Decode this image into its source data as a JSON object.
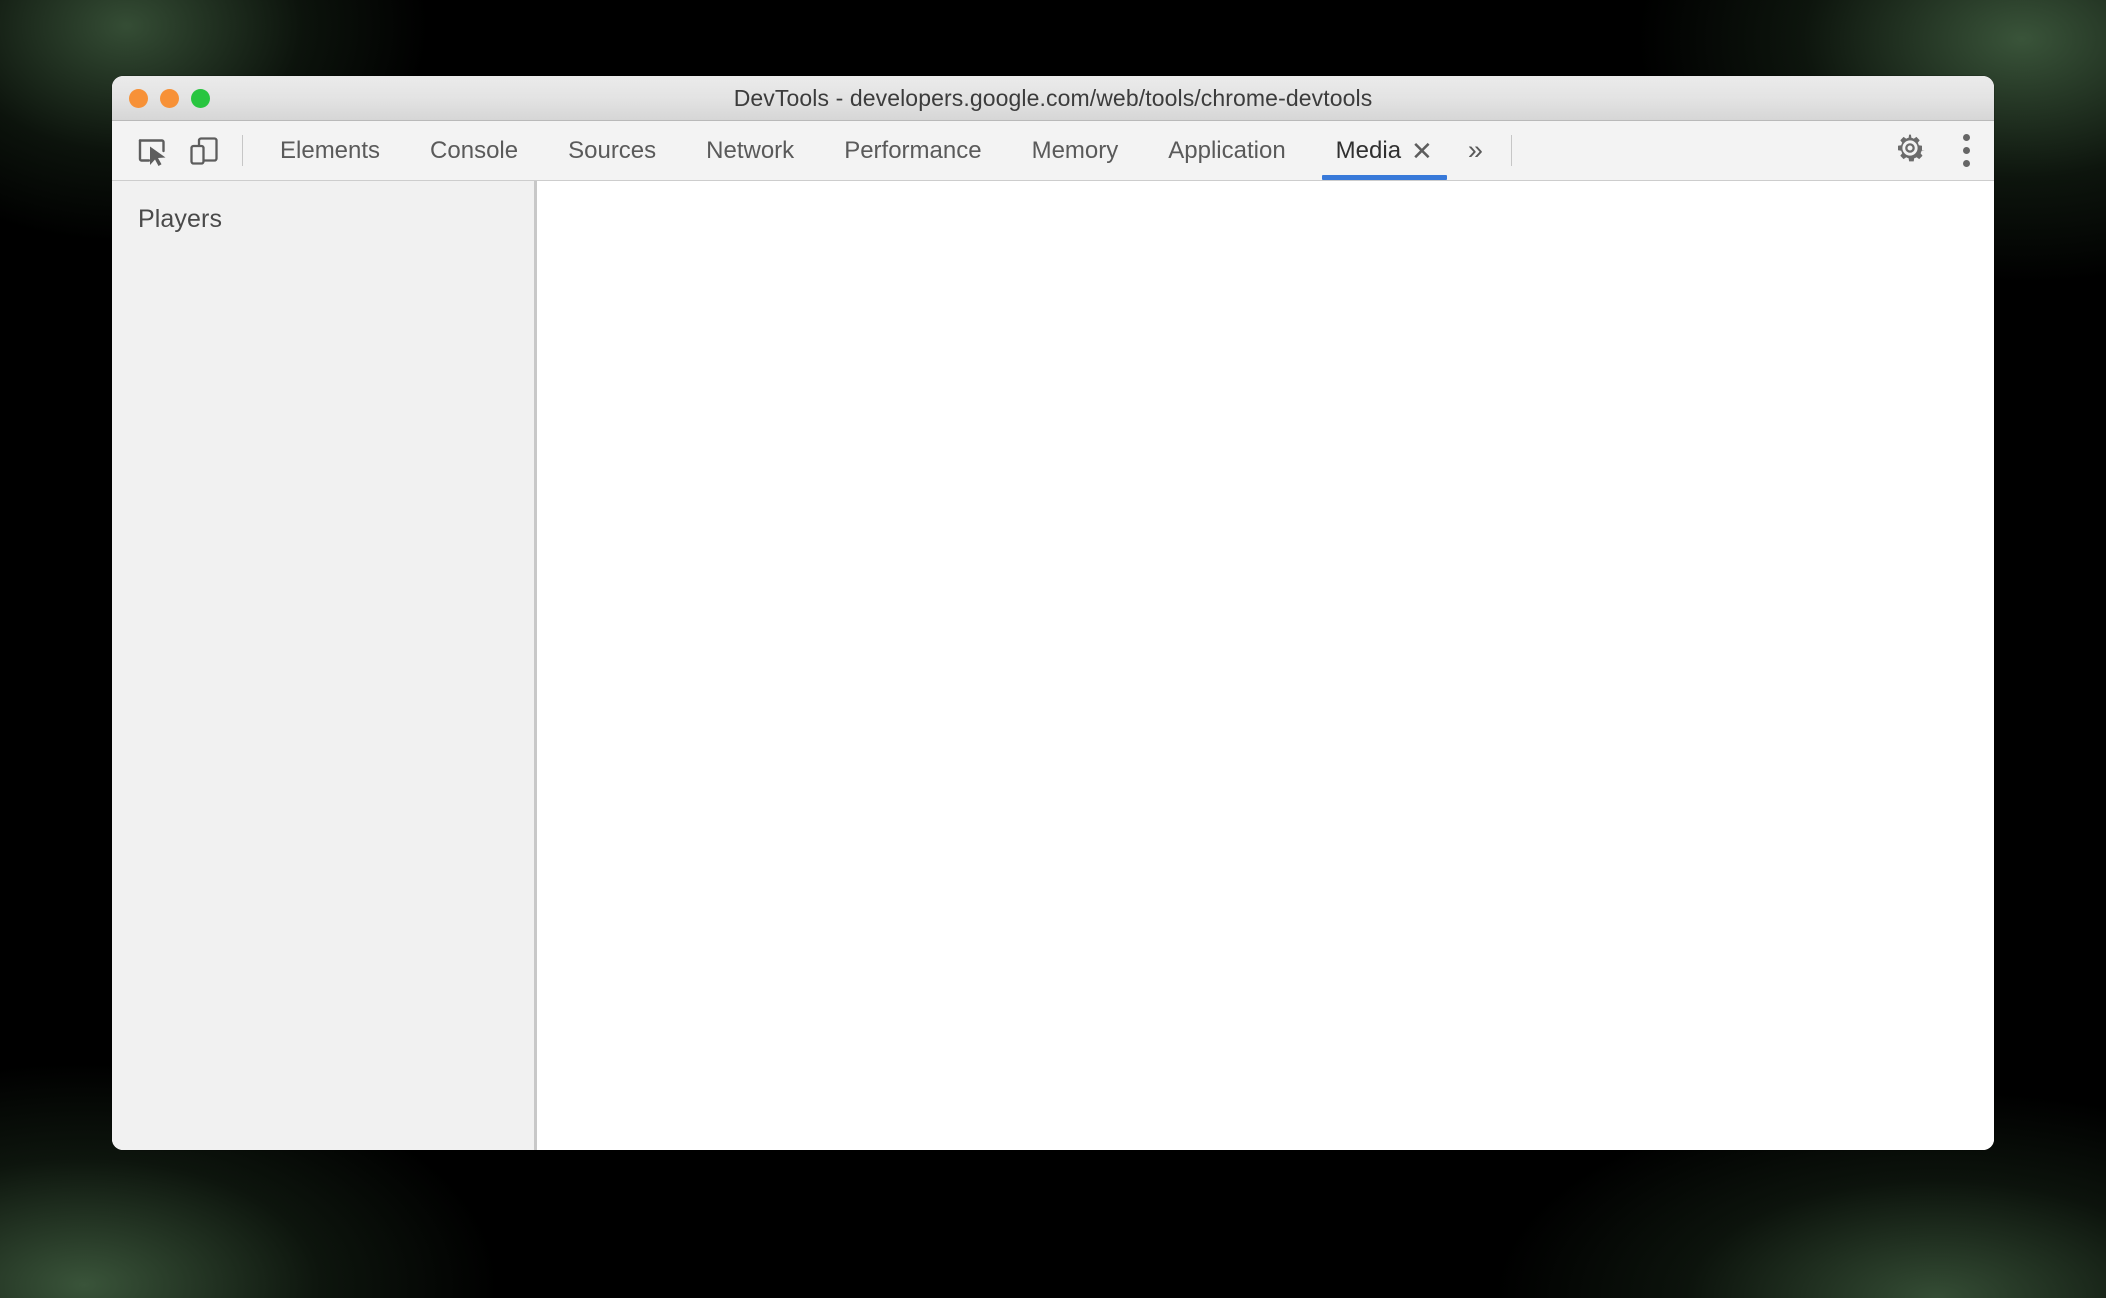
{
  "window": {
    "title": "DevTools - developers.google.com/web/tools/chrome-devtools",
    "traffic_lights": [
      {
        "name": "close-button",
        "color": "#f79137"
      },
      {
        "name": "minimize-button",
        "color": "#f79137"
      },
      {
        "name": "maximize-button",
        "color": "#28c53f"
      }
    ]
  },
  "toolbar": {
    "inspect_icon": "inspect-element-icon",
    "device_icon": "device-toolbar-icon",
    "overflow_label": "»",
    "settings_icon": "gear-icon",
    "more_icon": "more-vertical-icon"
  },
  "tabs": [
    {
      "label": "Elements",
      "selected": false,
      "closable": false
    },
    {
      "label": "Console",
      "selected": false,
      "closable": false
    },
    {
      "label": "Sources",
      "selected": false,
      "closable": false
    },
    {
      "label": "Network",
      "selected": false,
      "closable": false
    },
    {
      "label": "Performance",
      "selected": false,
      "closable": false
    },
    {
      "label": "Memory",
      "selected": false,
      "closable": false
    },
    {
      "label": "Application",
      "selected": false,
      "closable": false
    },
    {
      "label": "Media",
      "selected": true,
      "closable": true,
      "close_label": "✕"
    }
  ],
  "sidebar": {
    "title": "Players",
    "items": []
  },
  "content": {
    "body_text": ""
  },
  "colors": {
    "accent": "#3879d9",
    "titlebar_top": "#ebebeb",
    "titlebar_bottom": "#d6d6d6",
    "tabbar_bg": "#f3f3f3",
    "sidebar_bg": "#f1f1f1",
    "content_bg": "#ffffff",
    "backdrop": "#000000",
    "text": "#5a5a5a"
  }
}
